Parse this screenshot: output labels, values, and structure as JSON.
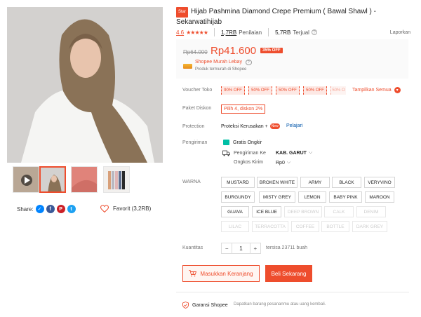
{
  "product": {
    "badge": "Star",
    "title": "Hijab Pashmina Diamond Crepe Premium ( Bawal Shawl ) - Sekarwatihijab",
    "rating": "4.6",
    "rating_count": "1,7RB",
    "rating_label": "Penilaian",
    "sold_count": "5,7RB",
    "sold_label": "Terjual",
    "report": "Laporkan"
  },
  "price": {
    "original": "Rp64.000",
    "current": "Rp41.600",
    "discount": "35% OFF",
    "promo_name": "Shopee Murah Lebay",
    "promo_sub": "Produk termurah di Shopee"
  },
  "voucher": {
    "label": "Voucher Toko",
    "chips": [
      "90% OFF",
      "50% OFF",
      "50% OFF",
      "50% OFF",
      "50% O"
    ],
    "show_all": "Tampilkan Semua"
  },
  "paket": {
    "label": "Paket Diskon",
    "value": "Pilih 4, diskon 2%"
  },
  "protection": {
    "label": "Protection",
    "value": "Proteksi Kerusakan +",
    "badge": "New",
    "link": "Pelajari"
  },
  "shipping": {
    "label": "Pengiriman",
    "free": "Gratis Ongkir",
    "to_label": "Pengiriman Ke",
    "to_value": "KAB. GARUT",
    "cost_label": "Ongkos Kirim",
    "cost_value": "Rp0"
  },
  "warna": {
    "label": "WARNA",
    "options": [
      {
        "name": "MUSTARD",
        "disabled": false
      },
      {
        "name": "BROKEN WHITE",
        "disabled": false
      },
      {
        "name": "ARMY",
        "disabled": false
      },
      {
        "name": "BLACK",
        "disabled": false
      },
      {
        "name": "VERYVINO",
        "disabled": false
      },
      {
        "name": "BURGUNDY",
        "disabled": false
      },
      {
        "name": "MISTY GREY",
        "disabled": false
      },
      {
        "name": "LEMON",
        "disabled": false
      },
      {
        "name": "BABY PINK",
        "disabled": false
      },
      {
        "name": "MAROON",
        "disabled": false
      },
      {
        "name": "GUAVA",
        "disabled": false
      },
      {
        "name": "ICE BLUE",
        "disabled": false
      },
      {
        "name": "DEEP BROWN",
        "disabled": true
      },
      {
        "name": "CALK",
        "disabled": true
      },
      {
        "name": "DENIM",
        "disabled": true
      },
      {
        "name": "LILAC",
        "disabled": true
      },
      {
        "name": "TERRACOTTA",
        "disabled": true
      },
      {
        "name": "COFFEE",
        "disabled": true
      },
      {
        "name": "BOTTLE",
        "disabled": true
      },
      {
        "name": "DARK GREY",
        "disabled": true
      }
    ]
  },
  "quantity": {
    "label": "Kuantitas",
    "minus": "−",
    "value": "1",
    "plus": "+",
    "stock": "tersisa 23711 buah"
  },
  "actions": {
    "cart": "Masukkan Keranjang",
    "buy": "Beli Sekarang"
  },
  "guarantee": {
    "title": "Garansi Shopee",
    "sub": "Dapatkan barang pesananmu atau uang kembali."
  },
  "share": {
    "label": "Share:"
  },
  "favorite": {
    "label": "Favorit (3,2RB)"
  },
  "colors": {
    "accent": "#ee4d2d",
    "link": "#0055aa"
  }
}
